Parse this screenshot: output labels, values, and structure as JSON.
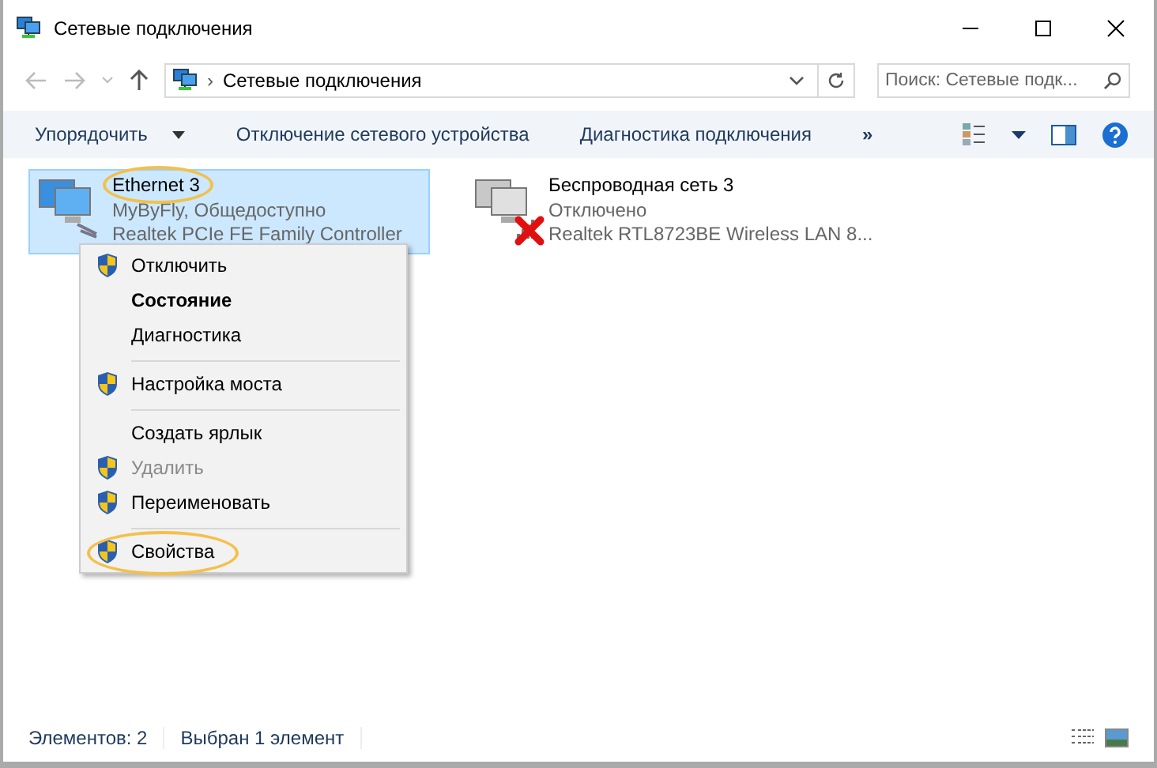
{
  "window": {
    "title": "Сетевые подключения"
  },
  "address": {
    "path": "Сетевые подключения",
    "separator": "›"
  },
  "search": {
    "placeholder": "Поиск: Сетевые подк..."
  },
  "toolbar": {
    "buttons": [
      {
        "label": "Упорядочить",
        "dropdown": true
      },
      {
        "label": "Отключение сетевого устройства",
        "dropdown": false
      },
      {
        "label": "Диагностика подключения",
        "dropdown": false
      }
    ],
    "overflow": "»"
  },
  "connections": [
    {
      "kind": "wired",
      "name": "Ethernet 3",
      "status": "MyByFly, Общедоступно",
      "adapter": "Realtek PCIe FE Family Controller",
      "selected": true,
      "circled": true,
      "crossed": false
    },
    {
      "kind": "wireless",
      "name": "Беспроводная сеть 3",
      "status": "Отключено",
      "adapter": "Realtek RTL8723BE Wireless LAN 8...",
      "selected": false,
      "circled": false,
      "crossed": true
    }
  ],
  "context_menu": [
    {
      "label": "Отключить",
      "shield": true,
      "bold": false,
      "disabled": false,
      "divider_after": false,
      "circled": false
    },
    {
      "label": "Состояние",
      "shield": false,
      "bold": true,
      "disabled": false,
      "divider_after": false,
      "circled": false
    },
    {
      "label": "Диагностика",
      "shield": false,
      "bold": false,
      "disabled": false,
      "divider_after": true,
      "circled": false
    },
    {
      "label": "Настройка моста",
      "shield": true,
      "bold": false,
      "disabled": false,
      "divider_after": true,
      "circled": false
    },
    {
      "label": "Создать ярлык",
      "shield": false,
      "bold": false,
      "disabled": false,
      "divider_after": false,
      "circled": false
    },
    {
      "label": "Удалить",
      "shield": true,
      "bold": false,
      "disabled": true,
      "divider_after": false,
      "circled": false
    },
    {
      "label": "Переименовать",
      "shield": true,
      "bold": false,
      "disabled": false,
      "divider_after": true,
      "circled": false
    },
    {
      "label": "Свойства",
      "shield": true,
      "bold": false,
      "disabled": false,
      "divider_after": false,
      "circled": true
    }
  ],
  "status_bar": {
    "count": "Элементов: 2",
    "selection": "Выбран 1 элемент"
  }
}
